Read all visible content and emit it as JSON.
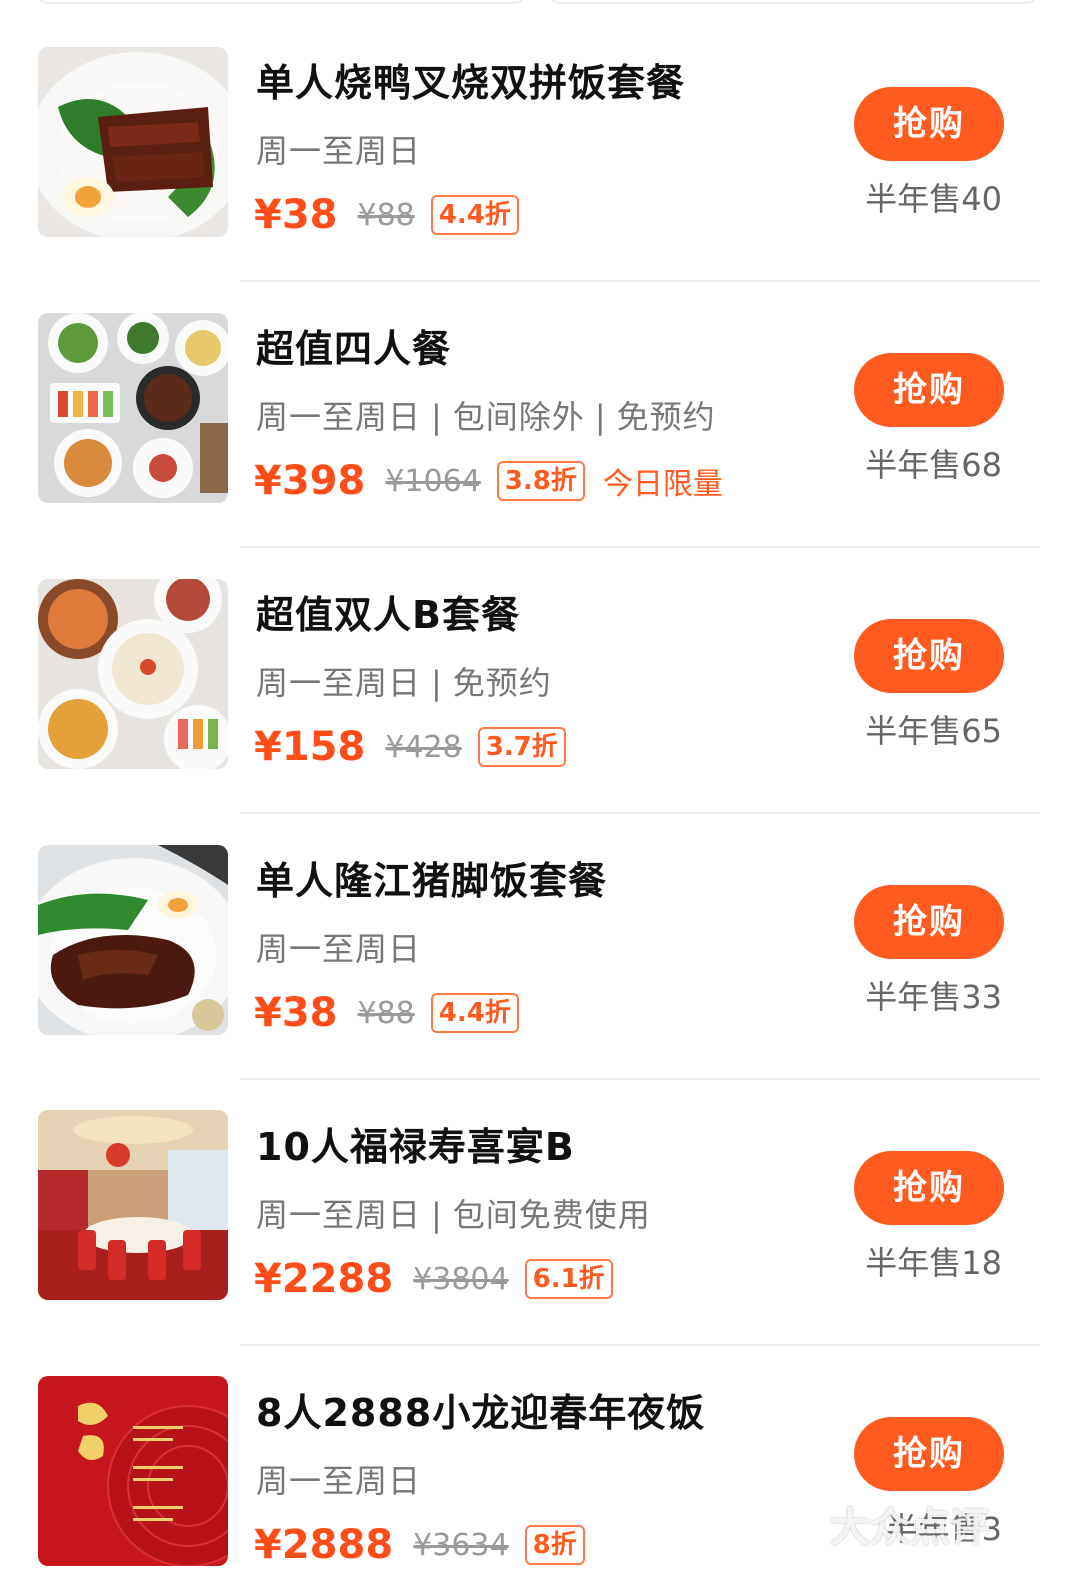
{
  "items": [
    {
      "title": "单人烧鸭叉烧双拼饭套餐",
      "subtitle": [
        "周一至周日"
      ],
      "price": "¥38",
      "original_price": "¥88",
      "discount": "4.4折",
      "tag": "",
      "buy_label": "抢购",
      "sold": "半年售40"
    },
    {
      "title": "超值四人餐",
      "subtitle": [
        "周一至周日",
        "包间除外",
        "免预约"
      ],
      "price": "¥398",
      "original_price": "¥1064",
      "discount": "3.8折",
      "tag": "今日限量",
      "buy_label": "抢购",
      "sold": "半年售68"
    },
    {
      "title": "超值双人B套餐",
      "subtitle": [
        "周一至周日",
        "免预约"
      ],
      "price": "¥158",
      "original_price": "¥428",
      "discount": "3.7折",
      "tag": "",
      "buy_label": "抢购",
      "sold": "半年售65"
    },
    {
      "title": "单人隆江猪脚饭套餐",
      "subtitle": [
        "周一至周日"
      ],
      "price": "¥38",
      "original_price": "¥88",
      "discount": "4.4折",
      "tag": "",
      "buy_label": "抢购",
      "sold": "半年售33"
    },
    {
      "title": "10人福禄寿喜宴B",
      "subtitle": [
        "周一至周日",
        "包间免费使用"
      ],
      "price": "¥2288",
      "original_price": "¥3804",
      "discount": "6.1折",
      "tag": "",
      "buy_label": "抢购",
      "sold": "半年售18"
    },
    {
      "title": "8人2888小龙迎春年夜饭",
      "subtitle": [
        "周一至周日"
      ],
      "price": "¥2888",
      "original_price": "¥3634",
      "discount": "8折",
      "tag": "",
      "buy_label": "抢购",
      "sold": "半年售3"
    }
  ],
  "watermark": "大众点评",
  "colors": {
    "accent": "#ff5a1f",
    "price": "#ff4d1a",
    "muted": "#777777"
  },
  "icons": [
    "food-photo-roast-duck",
    "food-photo-four-person-set",
    "food-photo-two-person-set",
    "food-photo-pork-knuckle",
    "banquet-room-photo",
    "new-year-dinner-poster"
  ]
}
